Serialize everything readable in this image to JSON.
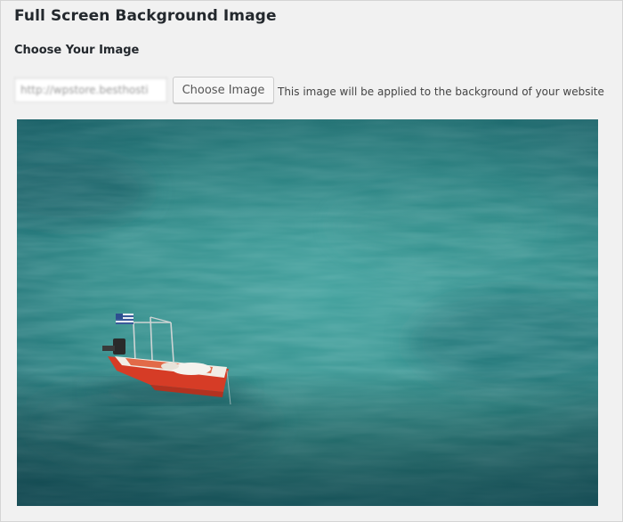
{
  "page": {
    "title": "Full Screen Background Image"
  },
  "field": {
    "label": "Choose Your Image",
    "url_value": "http://wpstore.besthosti",
    "button_label": "Choose Image",
    "hint": "This image will be applied to the background of your website"
  },
  "preview": {
    "description": "sea water with small red and white boat",
    "colors": {
      "water_light": "#4aa6a0",
      "water_mid": "#2e8a88",
      "water_dark": "#15585d",
      "boat_hull": "#d9402a",
      "boat_deck": "#f1ede6"
    }
  }
}
